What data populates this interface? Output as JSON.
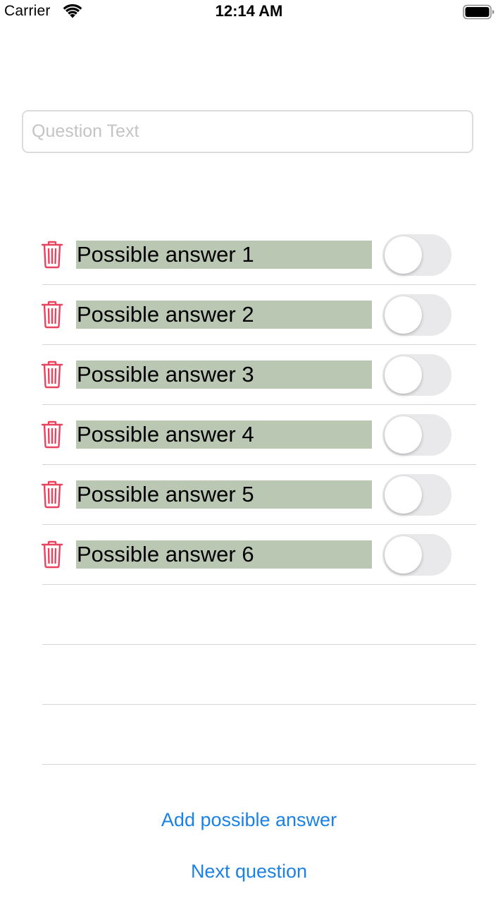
{
  "status_bar": {
    "carrier": "Carrier",
    "time": "12:14 AM",
    "icons": [
      "wifi-icon",
      "battery-icon"
    ]
  },
  "question": {
    "value": "",
    "placeholder": "Question Text"
  },
  "answers": [
    {
      "label": "Possible answer 1",
      "correct": false
    },
    {
      "label": "Possible answer 2",
      "correct": false
    },
    {
      "label": "Possible answer 3",
      "correct": false
    },
    {
      "label": "Possible answer 4",
      "correct": false
    },
    {
      "label": "Possible answer 5",
      "correct": false
    },
    {
      "label": "Possible answer 6",
      "correct": false
    }
  ],
  "actions": {
    "add_answer_label": "Add possible answer",
    "next_question_label": "Next question"
  },
  "colors": {
    "accent": "#1a82e6",
    "delete": "#e8435f",
    "answer_highlight": "#bac7b3",
    "toggle_off": "#e9e9eb"
  }
}
